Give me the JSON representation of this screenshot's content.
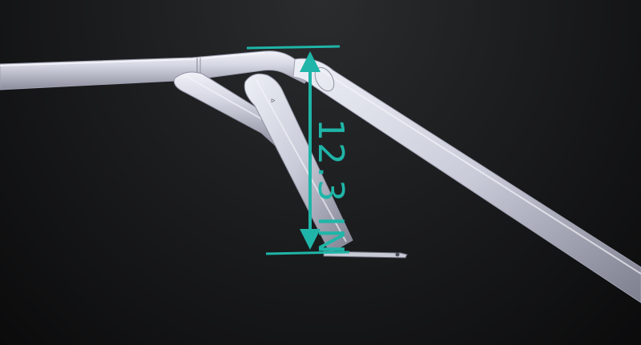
{
  "measurement": {
    "label": "12.3 IN"
  },
  "colors": {
    "dimension": "#1fb5a8",
    "tube_light": "#e4e5ef",
    "tube_mid": "#b8bacb",
    "tube_dark": "#6e7080",
    "background_top": "#2b2c2e",
    "background_bottom": "#0b0b0c"
  }
}
